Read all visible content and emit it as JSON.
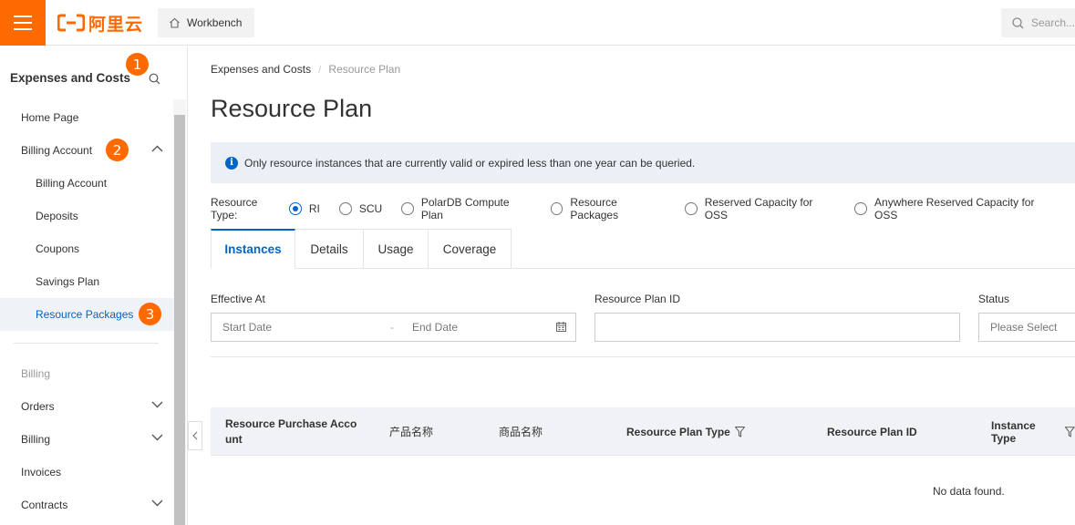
{
  "topbar": {
    "logo_text": "阿里云",
    "workbench_label": "Workbench",
    "search_placeholder": "Search..."
  },
  "sidebar": {
    "title": "Expenses and Costs",
    "items": {
      "home": "Home Page",
      "billing_account": "Billing Account",
      "billing_account_sub": "Billing Account",
      "deposits": "Deposits",
      "coupons": "Coupons",
      "savings_plan": "Savings Plan",
      "resource_packages": "Resource Packages",
      "billing_section": "Billing",
      "orders": "Orders",
      "billing": "Billing",
      "invoices": "Invoices",
      "contracts": "Contracts"
    }
  },
  "badges": {
    "one": "1",
    "two": "2",
    "three": "3"
  },
  "breadcrumb": {
    "parent": "Expenses and Costs",
    "separator": "/",
    "current": "Resource Plan"
  },
  "page_title": "Resource Plan",
  "notice": "Only resource instances that are currently valid or expired less than one year can be queried.",
  "resource_type": {
    "label": "Resource Type:",
    "options": [
      "RI",
      "SCU",
      "PolarDB Compute Plan",
      "Resource Packages",
      "Reserved Capacity for OSS",
      "Anywhere Reserved Capacity for OSS"
    ],
    "selected": "RI"
  },
  "tabs": [
    "Instances",
    "Details",
    "Usage",
    "Coverage"
  ],
  "active_tab": "Instances",
  "filters": {
    "effective_at_label": "Effective At",
    "start_placeholder": "Start Date",
    "range_sep": "-",
    "end_placeholder": "End Date",
    "plan_id_label": "Resource Plan ID",
    "plan_id_value": "",
    "status_label": "Status",
    "status_placeholder": "Please Select"
  },
  "table": {
    "columns": [
      "Resource Purchase Account",
      "产品名称",
      "商品名称",
      "Resource Plan Type",
      "Resource Plan ID",
      "Instance Type"
    ],
    "empty_text": "No data found."
  },
  "colors": {
    "brand": "#ff6a00",
    "accent": "#0064c8"
  }
}
